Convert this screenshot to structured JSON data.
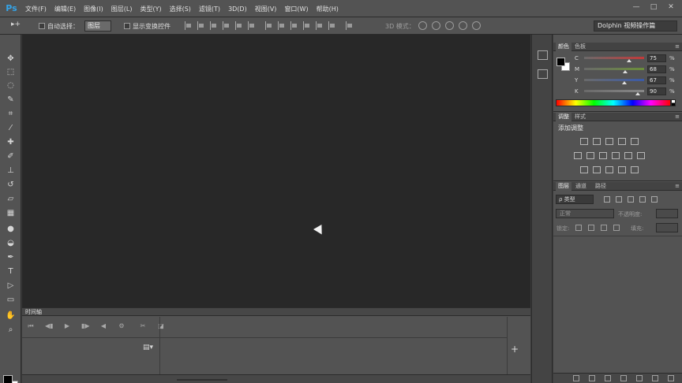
{
  "app": {
    "logo": "Ps"
  },
  "menu": [
    "文件(F)",
    "编辑(E)",
    "图像(I)",
    "图层(L)",
    "类型(Y)",
    "选择(S)",
    "滤镜(T)",
    "3D(D)",
    "视图(V)",
    "窗口(W)",
    "帮助(H)"
  ],
  "window_controls": {
    "minimize": "—",
    "maximize": "□",
    "close": "✕"
  },
  "options": {
    "tool_glyph": "▸+",
    "auto_select_label": "自动选择：",
    "auto_select_value": "图层",
    "show_transform_label": "显示变换控件",
    "mode_3d_label": "3D 模式：",
    "workspace": "Dolphin 视频操作篇"
  },
  "tools": [
    {
      "name": "move-tool-icon",
      "glyph": "✥"
    },
    {
      "name": "marquee-tool-icon",
      "glyph": "⬚"
    },
    {
      "name": "lasso-tool-icon",
      "glyph": "◌"
    },
    {
      "name": "quick-select-tool-icon",
      "glyph": "✎"
    },
    {
      "name": "crop-tool-icon",
      "glyph": "⌗"
    },
    {
      "name": "eyedropper-tool-icon",
      "glyph": "⁄"
    },
    {
      "name": "healing-brush-tool-icon",
      "glyph": "✚"
    },
    {
      "name": "brush-tool-icon",
      "glyph": "✐"
    },
    {
      "name": "clone-stamp-tool-icon",
      "glyph": "⊥"
    },
    {
      "name": "history-brush-tool-icon",
      "glyph": "↺"
    },
    {
      "name": "eraser-tool-icon",
      "glyph": "▱"
    },
    {
      "name": "gradient-tool-icon",
      "glyph": "▦"
    },
    {
      "name": "blur-tool-icon",
      "glyph": "●"
    },
    {
      "name": "dodge-tool-icon",
      "glyph": "◒"
    },
    {
      "name": "pen-tool-icon",
      "glyph": "✒"
    },
    {
      "name": "type-tool-icon",
      "glyph": "T"
    },
    {
      "name": "path-select-tool-icon",
      "glyph": "▷"
    },
    {
      "name": "shape-tool-icon",
      "glyph": "▭"
    },
    {
      "name": "hand-tool-icon",
      "glyph": "✋"
    },
    {
      "name": "zoom-tool-icon",
      "glyph": "⌕"
    }
  ],
  "timeline": {
    "tab": "时间轴",
    "controls": [
      "⏮",
      "◀▮",
      "▶",
      "▮▶",
      "◀",
      "⚙",
      "✂",
      "◪"
    ],
    "film_glyph": "▤▾",
    "add_glyph": "+"
  },
  "color_panel": {
    "tabs": [
      "颜色",
      "色板"
    ],
    "menu_glyph": "≡",
    "channels": [
      {
        "label": "C",
        "value": "75",
        "fraction": 0.75,
        "color": "#c23a3a"
      },
      {
        "label": "M",
        "value": "68",
        "fraction": 0.68,
        "color": "#6b8e3a"
      },
      {
        "label": "Y",
        "value": "67",
        "fraction": 0.67,
        "color": "#3a5aa8"
      },
      {
        "label": "K",
        "value": "90",
        "fraction": 0.9,
        "color": "#888888"
      }
    ],
    "percent": "%"
  },
  "adjustments_panel": {
    "tabs": [
      "调整",
      "样式"
    ],
    "title": "添加调整"
  },
  "layers_panel": {
    "tabs": [
      "图层",
      "通道",
      "路径"
    ],
    "filter": "ρ 类型",
    "blend_mode": "正常",
    "opacity_label": "不透明度:",
    "lock_label": "锁定:",
    "fill_label": "填充:"
  }
}
